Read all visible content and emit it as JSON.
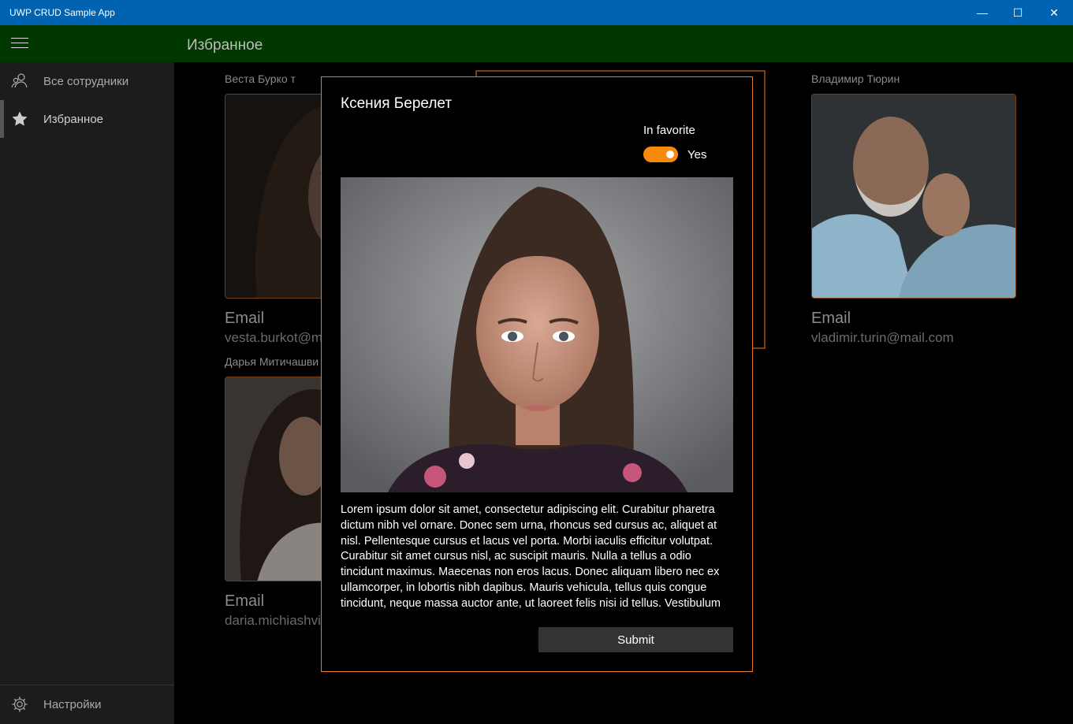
{
  "window": {
    "title": "UWP CRUD Sample App",
    "minimize_glyph": "—",
    "maximize_glyph": "☐",
    "close_glyph": "✕"
  },
  "header": {
    "page_title": "Избранное"
  },
  "nav": {
    "items": [
      {
        "label": "Все сотрудники",
        "icon": "people-icon"
      },
      {
        "label": "Избранное",
        "icon": "star-icon",
        "selected": true
      }
    ],
    "settings": {
      "label": "Настройки",
      "icon": "gear-icon"
    }
  },
  "cards": [
    {
      "name": "Веста Бурко т",
      "email_label": "Email",
      "email": "vesta.burkot@m"
    },
    {
      "name": "Дарья Митичашви",
      "email_label": "Email",
      "email": "daria.michiashvil"
    },
    {
      "name": "Владимир Тюрин",
      "email_label": "Email",
      "email": "vladimir.turin@mail.com"
    }
  ],
  "dialog": {
    "title": "Ксения Берелет",
    "favorite_label": "In favorite",
    "favorite_value": "Yes",
    "favorite_on": true,
    "description": "Lorem ipsum dolor sit amet, consectetur adipiscing elit. Curabitur pharetra dictum nibh vel ornare. Donec sem urna, rhoncus sed cursus ac, aliquet at nisl. Pellentesque cursus et lacus vel porta. Morbi iaculis efficitur volutpat. Curabitur sit amet cursus nisl, ac suscipit mauris. Nulla a tellus a odio tincidunt maximus. Maecenas non eros lacus. Donec aliquam libero nec ex ullamcorper, in lobortis nibh dapibus. Mauris vehicula, tellus quis congue tincidunt, neque massa auctor ante, ut laoreet felis nisi id tellus. Vestibulum",
    "submit_label": "Submit"
  },
  "colors": {
    "titlebar": "#0063b1",
    "header": "#003800",
    "accent": "#f7890c",
    "dialog_border": "#e07a2e"
  }
}
